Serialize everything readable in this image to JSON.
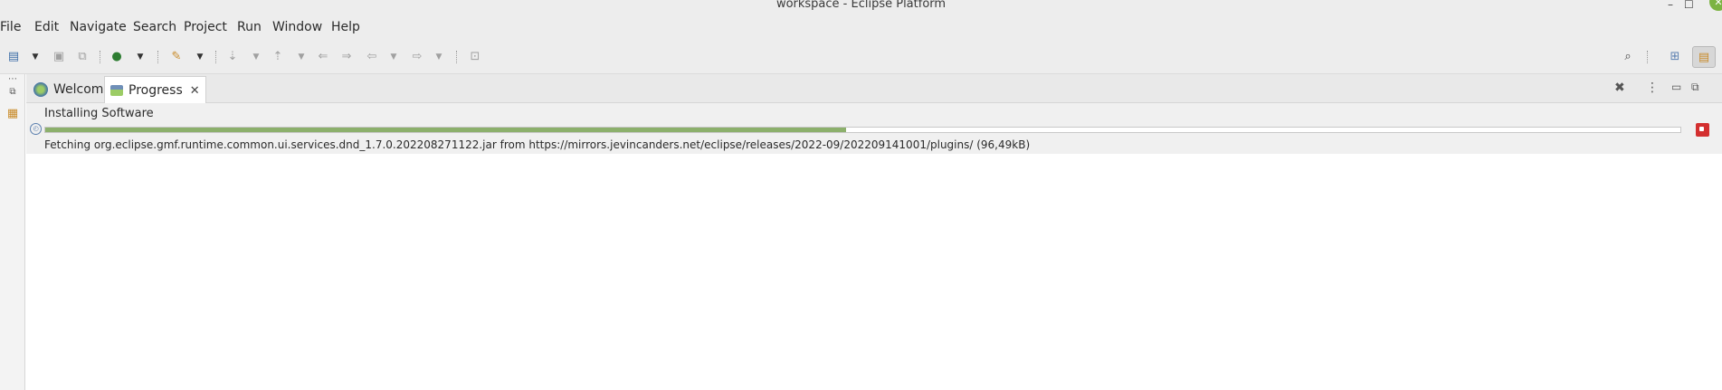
{
  "window": {
    "title": "workspace - Eclipse Platform"
  },
  "menu": {
    "file": "File",
    "edit": "Edit",
    "navigate": "Navigate",
    "search": "Search",
    "project": "Project",
    "run": "Run",
    "window": "Window",
    "help": "Help"
  },
  "tabs": {
    "welcome": "Welcome",
    "progress": "Progress"
  },
  "progress": {
    "job_name": "Installing Software",
    "fraction": 0.49,
    "detail": "Fetching org.eclipse.gmf.runtime.common.ui.services.dnd_1.7.0.202208271122.jar from https://mirrors.jevincanders.net/eclipse/releases/2022-09/202209141001/plugins/ (96,49kB)"
  },
  "colors": {
    "progress_fill": "#8cb06c",
    "stop": "#d32f2f",
    "close_button": "#7cb342"
  },
  "icons": {
    "new": "new-icon",
    "save": "save-icon",
    "save_all": "save-all-icon",
    "debug": "debug-icon",
    "external_tools": "external-tools-icon",
    "search": "search-icon",
    "open_perspective": "open-perspective-icon"
  }
}
